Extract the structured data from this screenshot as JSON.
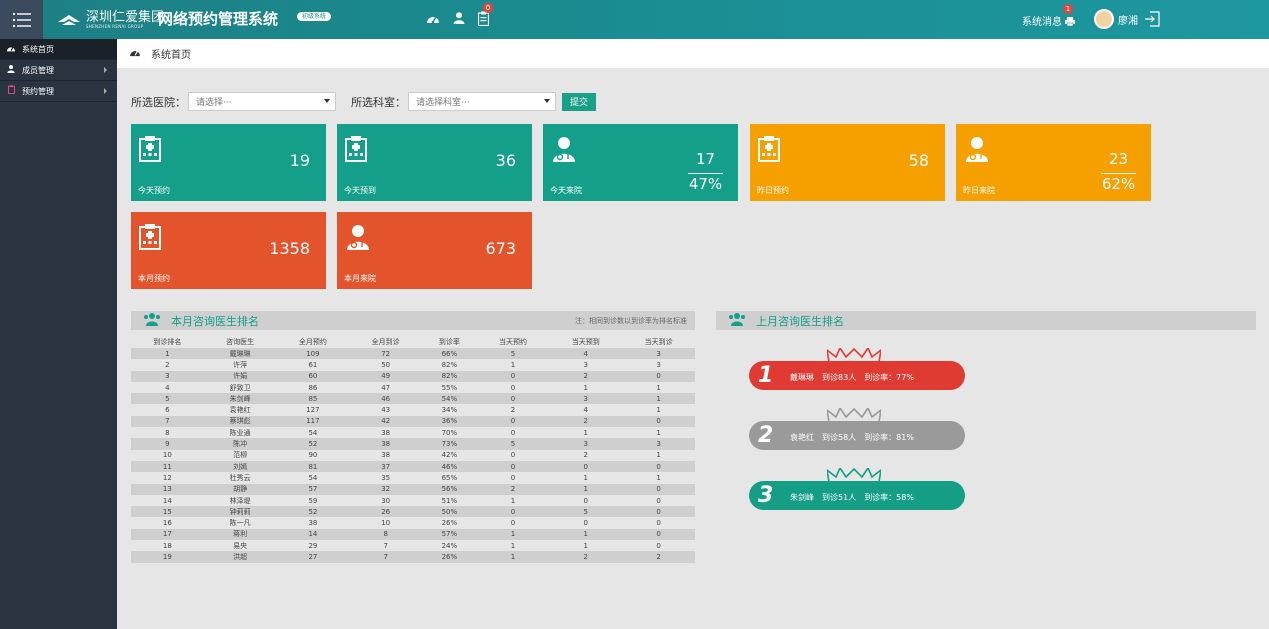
{
  "header": {
    "logo_cn": "深圳仁爱集团",
    "logo_en": "SHENZHEN RENAI GROUP",
    "system_name": "网络预约管理系统",
    "version_badge": "初级系统",
    "notification_count": "0",
    "system_message_label": "系统消息",
    "system_message_count": "1",
    "user_name": "廖湘"
  },
  "sidebar": {
    "items": [
      {
        "label": "系统首页",
        "icon": "dashboard-icon"
      },
      {
        "label": "成员管理",
        "icon": "user-icon"
      },
      {
        "label": "预约管理",
        "icon": "clipboard-icon"
      }
    ]
  },
  "breadcrumb": "系统首页",
  "filter": {
    "hospital_label": "所选医院：",
    "hospital_placeholder": "请选择···",
    "dept_label": "所选科室：",
    "dept_placeholder": "请选择科室···",
    "submit_label": "提交"
  },
  "cards": [
    {
      "label": "今天预约",
      "value": "19",
      "color": "#139f8a",
      "icon": "hospital-icon"
    },
    {
      "label": "今天预到",
      "value": "36",
      "color": "#139f8a",
      "icon": "hospital-icon"
    },
    {
      "label": "今天来院",
      "value": "17",
      "pct": "47%",
      "color": "#139f8a",
      "icon": "doctor-icon"
    },
    {
      "label": "昨日预约",
      "value": "58",
      "color": "#f6a000",
      "icon": "hospital-icon"
    },
    {
      "label": "昨日来院",
      "value": "23",
      "pct": "62%",
      "color": "#f6a000",
      "icon": "doctor-icon"
    },
    {
      "label": "本月预约",
      "value": "1358",
      "color": "#e4542c",
      "icon": "hospital-icon"
    },
    {
      "label": "本月来院",
      "value": "673",
      "color": "#e4542c",
      "icon": "doctor-icon"
    }
  ],
  "month_rank": {
    "title": "本月咨询医生排名",
    "note": "注：相同到诊数以到诊率为排名标准",
    "columns": [
      "到诊排名",
      "咨询医生",
      "全月预约",
      "全月到诊",
      "到诊率",
      "当天预约",
      "当天预到",
      "当天到诊"
    ],
    "rows": [
      [
        "1",
        "戴琳琳",
        "109",
        "72",
        "66%",
        "5",
        "4",
        "3"
      ],
      [
        "2",
        "许萍",
        "61",
        "50",
        "82%",
        "1",
        "3",
        "3"
      ],
      [
        "3",
        "许娟",
        "60",
        "49",
        "82%",
        "0",
        "2",
        "0"
      ],
      [
        "4",
        "舒致卫",
        "86",
        "47",
        "55%",
        "0",
        "1",
        "1"
      ],
      [
        "5",
        "朱剑峰",
        "85",
        "46",
        "54%",
        "0",
        "3",
        "1"
      ],
      [
        "6",
        "袁艳红",
        "127",
        "43",
        "34%",
        "2",
        "4",
        "1"
      ],
      [
        "7",
        "蔡琪彪",
        "117",
        "42",
        "36%",
        "0",
        "2",
        "0"
      ],
      [
        "8",
        "陈业通",
        "54",
        "38",
        "70%",
        "0",
        "1",
        "1"
      ],
      [
        "9",
        "陈冲",
        "52",
        "38",
        "73%",
        "5",
        "3",
        "3"
      ],
      [
        "10",
        "范柳",
        "90",
        "38",
        "42%",
        "0",
        "2",
        "1"
      ],
      [
        "11",
        "刘嫣",
        "81",
        "37",
        "46%",
        "0",
        "0",
        "0"
      ],
      [
        "12",
        "杜秀云",
        "54",
        "35",
        "65%",
        "0",
        "1",
        "1"
      ],
      [
        "13",
        "胡静",
        "57",
        "32",
        "56%",
        "2",
        "1",
        "0"
      ],
      [
        "14",
        "林泽堤",
        "59",
        "30",
        "51%",
        "1",
        "0",
        "0"
      ],
      [
        "15",
        "钟莉莉",
        "52",
        "26",
        "50%",
        "0",
        "5",
        "0"
      ],
      [
        "16",
        "陈一凡",
        "38",
        "10",
        "26%",
        "0",
        "0",
        "0"
      ],
      [
        "17",
        "蒋利",
        "14",
        "8",
        "57%",
        "1",
        "1",
        "0"
      ],
      [
        "18",
        "易央",
        "29",
        "7",
        "24%",
        "1",
        "1",
        "0"
      ],
      [
        "19",
        "洪超",
        "27",
        "7",
        "26%",
        "1",
        "2",
        "2"
      ]
    ]
  },
  "last_rank": {
    "title": "上月咨询医生排名",
    "items": [
      {
        "rank": "1",
        "name": "戴琳琳",
        "visits": "到诊83人",
        "rate": "到诊率：77%",
        "color": "#e03b32",
        "crown_color": "#e03b32"
      },
      {
        "rank": "2",
        "name": "袁艳红",
        "visits": "到诊58人",
        "rate": "到诊率：81%",
        "color": "#9a9a9a",
        "crown_color": "#999999"
      },
      {
        "rank": "3",
        "name": "朱剑峰",
        "visits": "到诊51人",
        "rate": "到诊率：58%",
        "color": "#149e86",
        "crown_color": "#149e86"
      }
    ]
  }
}
